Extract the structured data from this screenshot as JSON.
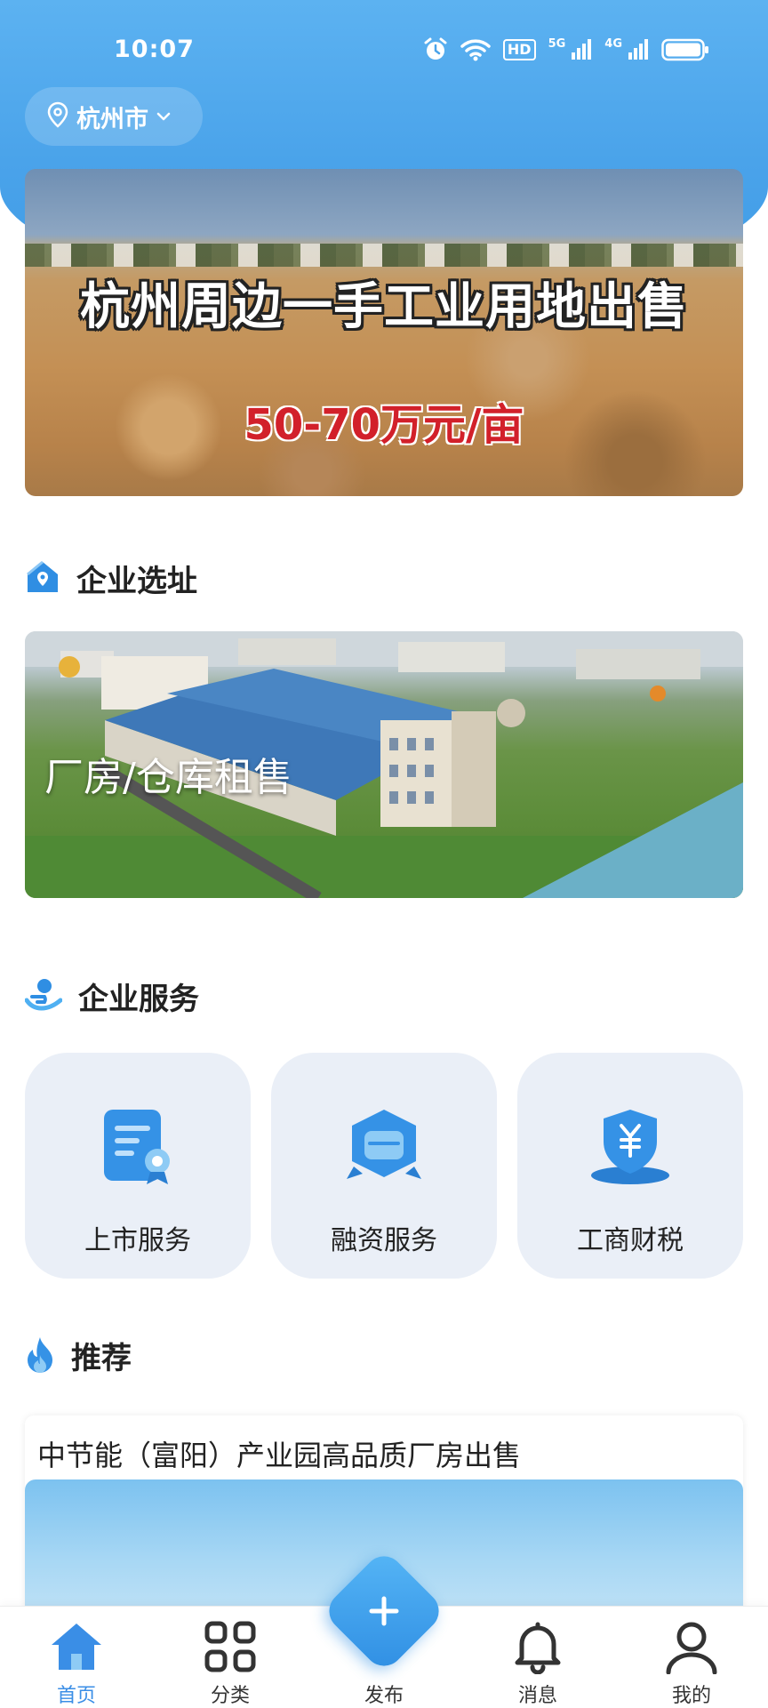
{
  "status_bar": {
    "time": "10:07",
    "hd_label": "HD",
    "net_5g": "5G",
    "net_4g": "4G"
  },
  "location": {
    "city": "杭州市"
  },
  "banner": {
    "title": "杭州周边一手工业用地出售",
    "subtitle": "50-70万元/亩"
  },
  "site_selection": {
    "section_title": "企业选址",
    "card_label": "厂房/仓库租售"
  },
  "enterprise_services": {
    "section_title": "企业服务",
    "items": [
      {
        "label": "上市服务",
        "icon": "certificate-icon"
      },
      {
        "label": "融资服务",
        "icon": "store-icon"
      },
      {
        "label": "工商财税",
        "icon": "yuan-shield-icon"
      }
    ]
  },
  "recommend": {
    "section_title": "推荐",
    "item_title": "中节能（富阳）产业园高品质厂房出售"
  },
  "tabbar": {
    "items": [
      {
        "label": "首页",
        "icon": "home-icon",
        "active": true
      },
      {
        "label": "分类",
        "icon": "grid-icon"
      },
      {
        "label": "发布",
        "icon": "plus-icon"
      },
      {
        "label": "消息",
        "icon": "bell-icon"
      },
      {
        "label": "我的",
        "icon": "user-icon"
      }
    ]
  },
  "colors": {
    "primary": "#3a8ee6",
    "header": "#4aa3ea",
    "card_bg": "#eaeff7",
    "banner_price": "#d2202a"
  }
}
